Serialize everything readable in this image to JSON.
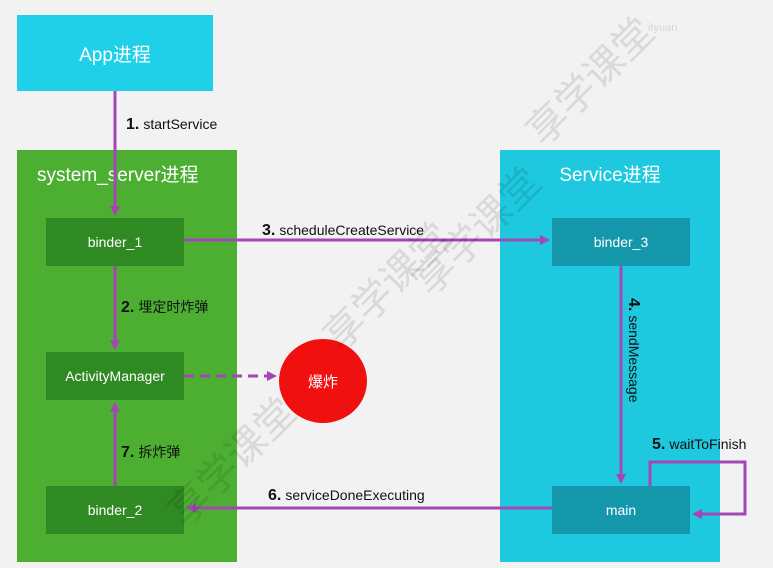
{
  "nodes": {
    "app": "App进程",
    "system_server": "system_server进程",
    "service_process": "Service进程",
    "binder_1": "binder_1",
    "activity_manager": "ActivityManager",
    "binder_2": "binder_2",
    "binder_3": "binder_3",
    "main": "main",
    "bomb": "爆炸"
  },
  "steps": [
    {
      "num": "1.",
      "label": "startService"
    },
    {
      "num": "2.",
      "label": "埋定时炸弹"
    },
    {
      "num": "3.",
      "label": "scheduleCreateService"
    },
    {
      "num": "4.",
      "label": "sendMessage"
    },
    {
      "num": "5.",
      "label": "waitToFinish"
    },
    {
      "num": "6.",
      "label": "serviceDoneExecuting"
    },
    {
      "num": "7.",
      "label": "拆炸弹"
    }
  ],
  "watermark": {
    "text": "享学课堂",
    "small": "ityuan"
  },
  "colors": {
    "arrow": "#a347b5",
    "app": "#1fd0e8",
    "system_server": "#4caf32",
    "service": "#1ec8de",
    "bomb": "#f01010"
  }
}
